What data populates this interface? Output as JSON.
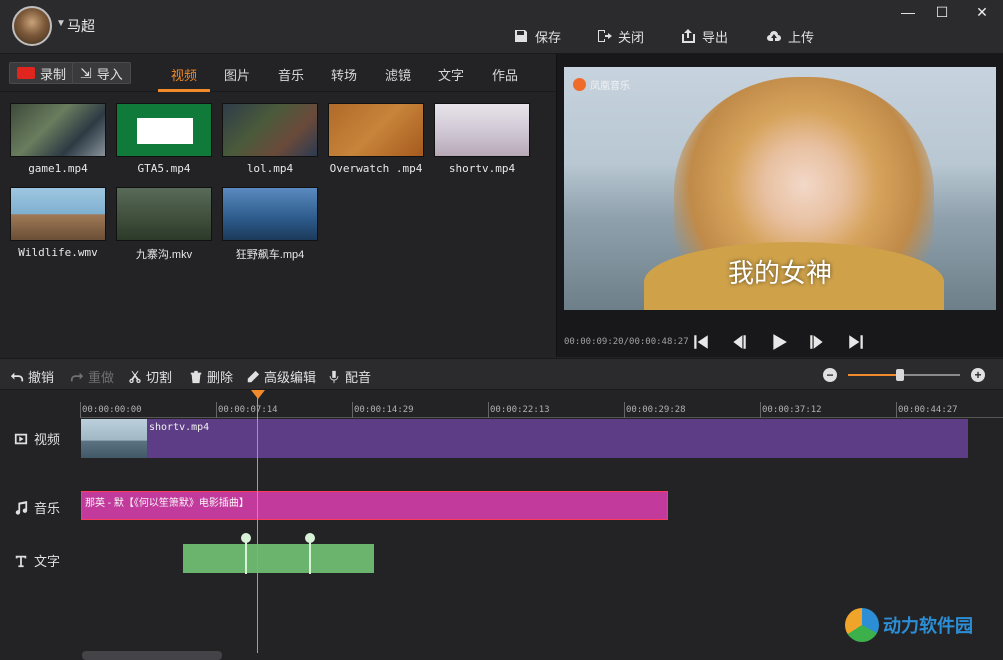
{
  "titlebar": {
    "username": "马超",
    "actions": {
      "save": "保存",
      "close": "关闭",
      "export": "导出",
      "upload": "上传"
    },
    "window": {
      "minimize": "—",
      "maximize": "☐",
      "close": "✕"
    }
  },
  "library": {
    "record_label": "录制",
    "import_label": "导入",
    "tabs": [
      "视频",
      "图片",
      "音乐",
      "转场",
      "滤镜",
      "文字",
      "作品"
    ],
    "active_tab": "视频",
    "items": [
      "game1.mp4",
      "GTA5.mp4",
      "lol.mp4",
      "Overwatch .mp4",
      "shortv.mp4",
      "Wildlife.wmv",
      "九寨沟.mkv",
      "狂野飙车.mp4"
    ]
  },
  "preview": {
    "logo_text": "凤凰音乐",
    "subtitle": "我的女神",
    "timecode": "00:00:09:20/00:00:48:27"
  },
  "toolbar": {
    "undo": "撤销",
    "redo": "重做",
    "cut": "切割",
    "delete": "删除",
    "advanced_edit": "高级编辑",
    "voiceover": "配音",
    "zoom_level": 0.46
  },
  "timeline": {
    "ruler": [
      "00:00:00:00",
      "00:00:07:14",
      "00:00:14:29",
      "00:00:22:13",
      "00:00:29:28",
      "00:00:37:12",
      "00:00:44:27"
    ],
    "tracks": {
      "video": "视频",
      "music": "音乐",
      "text": "文字"
    },
    "video_clip": "shortv.mp4",
    "music_clip": "那英 - 默【《何以笙箫默》电影插曲】"
  },
  "watermark": {
    "title": "动力软件园"
  },
  "colors": {
    "accent": "#f08a2a",
    "video_clip": "#5d3e86",
    "music_clip": "#c13a9c",
    "text_clip": "#6ab46d"
  }
}
